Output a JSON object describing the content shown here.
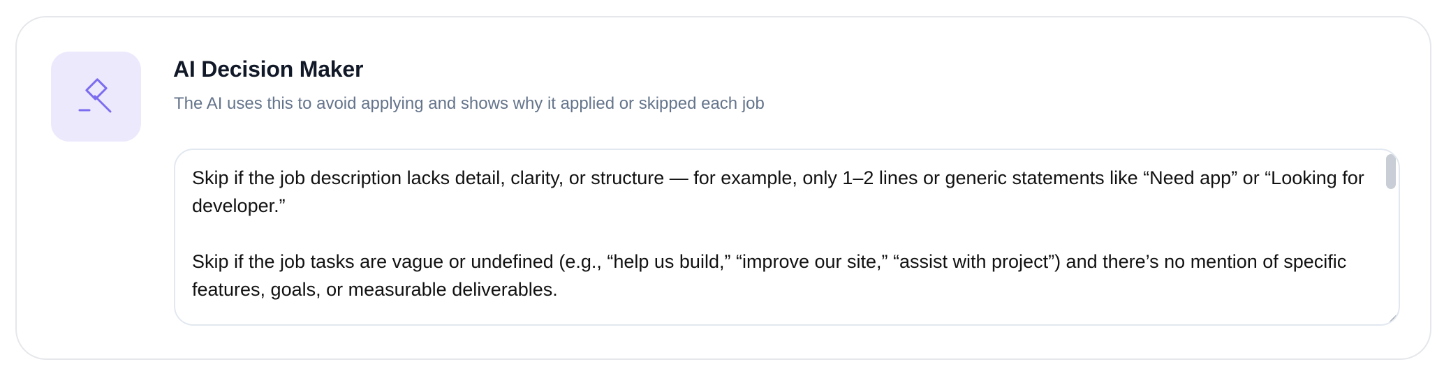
{
  "card": {
    "title": "AI Decision Maker",
    "subtitle": "The AI uses this to avoid applying and shows why it applied or skipped each job",
    "icon": "eraser-icon"
  },
  "textarea": {
    "paragraphs": [
      "Skip if the job description lacks detail, clarity, or structure — for example, only 1–2 lines or generic statements like “Need app” or “Looking for developer.”",
      "Skip if the job tasks are vague or undefined (e.g., “help us build,” “improve our site,” “assist with project”) and there’s no mention of specific features, goals, or measurable deliverables."
    ]
  },
  "colors": {
    "accent": "#7c6cf0",
    "icon_tile_bg": "#ece9fd",
    "border": "#e5e7eb",
    "subtitle": "#64748b"
  }
}
